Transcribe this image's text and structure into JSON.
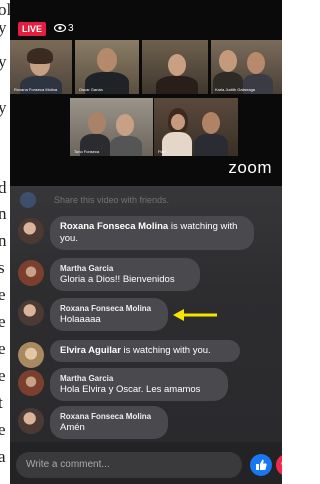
{
  "stream": {
    "live_label": "LIVE",
    "viewer_count": "3",
    "provider_logo": "zoom"
  },
  "participants": [
    {
      "name": "Roxana Fonseca Molina"
    },
    {
      "name": "Oscar Garcia"
    },
    {
      "name": ""
    },
    {
      "name": "Karla Judith Galarraga"
    },
    {
      "name": "Tono Fonseca"
    },
    {
      "name": "Flori"
    }
  ],
  "chat": {
    "share_prompt": "Share this video with friends.",
    "messages": [
      {
        "type": "event",
        "name": "Roxana Fonseca Molina",
        "action": "is watching with",
        "action2": "you."
      },
      {
        "type": "comment",
        "author": "Martha Garcia",
        "text": "Gloria a Dios!! Bienvenidos"
      },
      {
        "type": "comment",
        "author": "Roxana Fonseca Molina",
        "text": "Holaaaaa"
      },
      {
        "type": "event",
        "name": "Elvira Aguilar",
        "action": "is watching with you."
      },
      {
        "type": "comment",
        "author": "Martha Garcia",
        "text": "Hola Elvira y Oscar. Les amamos"
      },
      {
        "type": "comment",
        "author": "Roxana Fonseca Molina",
        "text": "Amén"
      }
    ]
  },
  "composer": {
    "placeholder": "Write a comment..."
  },
  "reactions": {
    "like_icon": "thumbs-up-icon",
    "love_icon": "heart-icon",
    "like_color": "#1877f2",
    "love_color": "#f02849"
  },
  "colors": {
    "live_red": "#e41e3f",
    "active_speaker": "#7bd84a",
    "annotation_arrow": "#f5e600"
  }
}
